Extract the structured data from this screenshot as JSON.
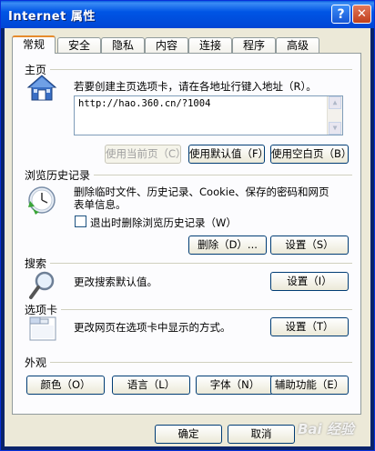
{
  "window": {
    "title": "Internet 属性",
    "help_glyph": "?",
    "close_glyph": "✕"
  },
  "tabs": [
    "常规",
    "安全",
    "隐私",
    "内容",
    "连接",
    "程序",
    "高级"
  ],
  "home": {
    "group_label": "主页",
    "desc": "若要创建主页选项卡，请在各地址行键入地址（R）。",
    "url": "http://hao.360.cn/?1004",
    "btn_current": "使用当前页（C）",
    "btn_default": "使用默认值（F）",
    "btn_blank": "使用空白页（B）"
  },
  "history": {
    "group_label": "浏览历史记录",
    "desc_line1": "删除临时文件、历史记录、Cookie、保存的密码和网页",
    "desc_line2": "表单信息。",
    "checkbox_label": "退出时删除浏览历史记录（W）",
    "checkbox_checked": false,
    "btn_delete": "删除（D）...",
    "btn_settings": "设置（S）"
  },
  "search": {
    "group_label": "搜索",
    "desc": "更改搜索默认值。",
    "btn_settings": "设置（I）"
  },
  "tabs_section": {
    "group_label": "选项卡",
    "desc": "更改网页在选项卡中显示的方式。",
    "btn_settings": "设置（T）"
  },
  "appearance": {
    "group_label": "外观",
    "btn_colors": "颜色（O）",
    "btn_languages": "语言（L）",
    "btn_fonts": "字体（N）",
    "btn_accessibility": "辅助功能（E）"
  },
  "footer": {
    "ok": "确定",
    "cancel": "取消"
  },
  "watermark": "Bai 经验"
}
